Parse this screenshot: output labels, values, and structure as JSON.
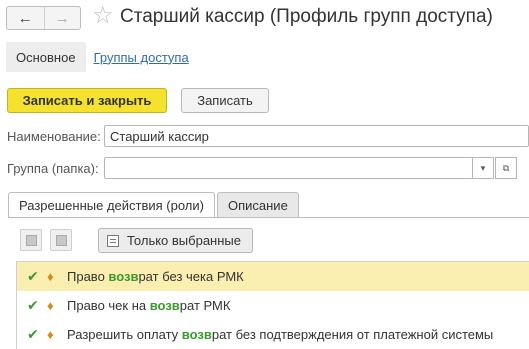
{
  "header": {
    "back_icon": "←",
    "forward_icon": "→",
    "star_icon": "☆",
    "title": "Старший кассир (Профиль групп доступа)"
  },
  "subnav": {
    "main": "Основное",
    "link": "Группы доступа"
  },
  "toolbar": {
    "save_close_label": "Записать и закрыть",
    "save_label": "Записать"
  },
  "form": {
    "name_label": "Наименование:",
    "name_value": "Старший кассир",
    "group_label": "Группа (папка):",
    "group_value": "",
    "dropdown_icon": "▾",
    "open_icon": "⧉"
  },
  "tabs": [
    "Разрешенные действия (роли)",
    "Описание"
  ],
  "roles_toolbar": {
    "only_selected_label": "Только выбранные"
  },
  "roles": [
    {
      "pre": "Право ",
      "hl": "возв",
      "post": "рат без чека РМК",
      "selected": true
    },
    {
      "pre": "Право чек на ",
      "hl": "возв",
      "post": "рат РМК",
      "selected": false
    },
    {
      "pre": "Разрешить оплату ",
      "hl": "возв",
      "post": "рат без подтверждения от платежной системы",
      "selected": false
    }
  ],
  "colors": {
    "accent_button": "#f5e22e",
    "selected_row": "#faeeb0",
    "check": "#3a9a2e",
    "link": "#2f6bb3"
  }
}
